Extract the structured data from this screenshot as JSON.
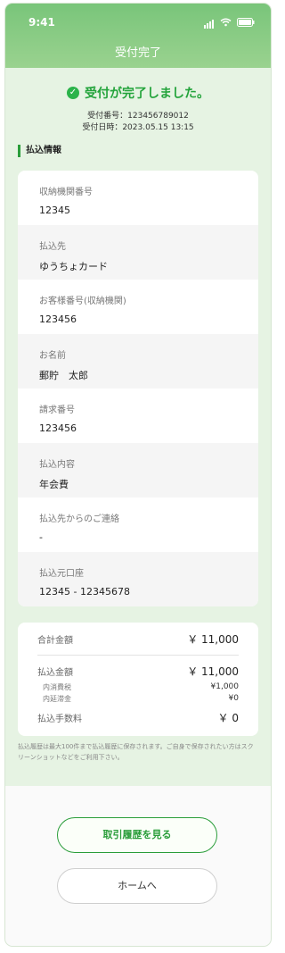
{
  "status": {
    "time": "9:41"
  },
  "header": {
    "title": "受付完了"
  },
  "result": {
    "message": "受付が完了しました。",
    "receipt_no": "受付番号：123456789012",
    "receipt_date": "受付日時：2023.05.15 13:15"
  },
  "section": {
    "title": "払込情報"
  },
  "details": [
    {
      "label": "収納機関番号",
      "value": "12345"
    },
    {
      "label": "払込先",
      "value": "ゆうちょカード"
    },
    {
      "label": "お客様番号(収納機関)",
      "value": "123456"
    },
    {
      "label": "お名前",
      "value": "郵貯　太郎"
    },
    {
      "label": "請求番号",
      "value": "123456"
    },
    {
      "label": "払込内容",
      "value": "年会費"
    },
    {
      "label": "払込先からのご連絡",
      "value": "-"
    },
    {
      "label": "払込元口座",
      "value": "12345 - 12345678"
    }
  ],
  "summary": {
    "total_label": "合計金額",
    "total": "￥ 11,000",
    "pay_label": "払込金額",
    "pay": "￥ 11,000",
    "tax_label": "内消費税",
    "tax": "¥1,000",
    "late_label": "内延滞金",
    "late": "¥0",
    "fee_label": "払込手数料",
    "fee": "￥ 0"
  },
  "note": "払込履歴は最大100件まで払込履歴に保存されます。ご自身で保存されたい方はスクリーンショットなどをご利用下さい。",
  "buttons": {
    "history": "取引履歴を見る",
    "home": "ホームへ"
  },
  "colors": {
    "accent": "#2a9d3a",
    "header": "#8ccc84",
    "background": "#e6f3e3"
  }
}
